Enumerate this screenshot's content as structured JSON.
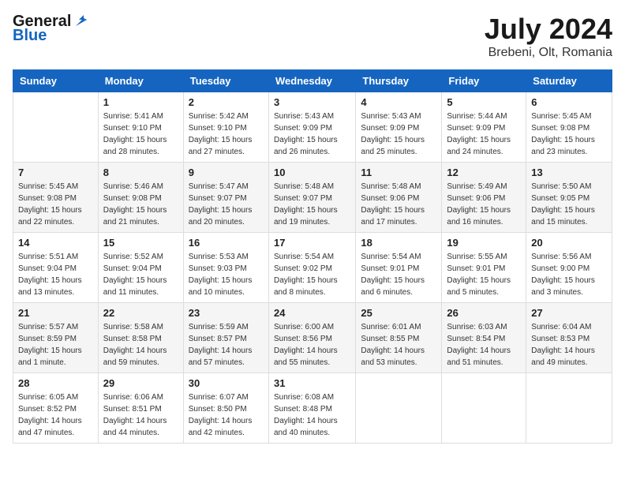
{
  "header": {
    "logo_line1": "General",
    "logo_line2": "Blue",
    "month_year": "July 2024",
    "location": "Brebeni, Olt, Romania"
  },
  "weekdays": [
    "Sunday",
    "Monday",
    "Tuesday",
    "Wednesday",
    "Thursday",
    "Friday",
    "Saturday"
  ],
  "weeks": [
    [
      {
        "day": "",
        "sunrise": "",
        "sunset": "",
        "daylight": ""
      },
      {
        "day": "1",
        "sunrise": "Sunrise: 5:41 AM",
        "sunset": "Sunset: 9:10 PM",
        "daylight": "Daylight: 15 hours and 28 minutes."
      },
      {
        "day": "2",
        "sunrise": "Sunrise: 5:42 AM",
        "sunset": "Sunset: 9:10 PM",
        "daylight": "Daylight: 15 hours and 27 minutes."
      },
      {
        "day": "3",
        "sunrise": "Sunrise: 5:43 AM",
        "sunset": "Sunset: 9:09 PM",
        "daylight": "Daylight: 15 hours and 26 minutes."
      },
      {
        "day": "4",
        "sunrise": "Sunrise: 5:43 AM",
        "sunset": "Sunset: 9:09 PM",
        "daylight": "Daylight: 15 hours and 25 minutes."
      },
      {
        "day": "5",
        "sunrise": "Sunrise: 5:44 AM",
        "sunset": "Sunset: 9:09 PM",
        "daylight": "Daylight: 15 hours and 24 minutes."
      },
      {
        "day": "6",
        "sunrise": "Sunrise: 5:45 AM",
        "sunset": "Sunset: 9:08 PM",
        "daylight": "Daylight: 15 hours and 23 minutes."
      }
    ],
    [
      {
        "day": "7",
        "sunrise": "Sunrise: 5:45 AM",
        "sunset": "Sunset: 9:08 PM",
        "daylight": "Daylight: 15 hours and 22 minutes."
      },
      {
        "day": "8",
        "sunrise": "Sunrise: 5:46 AM",
        "sunset": "Sunset: 9:08 PM",
        "daylight": "Daylight: 15 hours and 21 minutes."
      },
      {
        "day": "9",
        "sunrise": "Sunrise: 5:47 AM",
        "sunset": "Sunset: 9:07 PM",
        "daylight": "Daylight: 15 hours and 20 minutes."
      },
      {
        "day": "10",
        "sunrise": "Sunrise: 5:48 AM",
        "sunset": "Sunset: 9:07 PM",
        "daylight": "Daylight: 15 hours and 19 minutes."
      },
      {
        "day": "11",
        "sunrise": "Sunrise: 5:48 AM",
        "sunset": "Sunset: 9:06 PM",
        "daylight": "Daylight: 15 hours and 17 minutes."
      },
      {
        "day": "12",
        "sunrise": "Sunrise: 5:49 AM",
        "sunset": "Sunset: 9:06 PM",
        "daylight": "Daylight: 15 hours and 16 minutes."
      },
      {
        "day": "13",
        "sunrise": "Sunrise: 5:50 AM",
        "sunset": "Sunset: 9:05 PM",
        "daylight": "Daylight: 15 hours and 15 minutes."
      }
    ],
    [
      {
        "day": "14",
        "sunrise": "Sunrise: 5:51 AM",
        "sunset": "Sunset: 9:04 PM",
        "daylight": "Daylight: 15 hours and 13 minutes."
      },
      {
        "day": "15",
        "sunrise": "Sunrise: 5:52 AM",
        "sunset": "Sunset: 9:04 PM",
        "daylight": "Daylight: 15 hours and 11 minutes."
      },
      {
        "day": "16",
        "sunrise": "Sunrise: 5:53 AM",
        "sunset": "Sunset: 9:03 PM",
        "daylight": "Daylight: 15 hours and 10 minutes."
      },
      {
        "day": "17",
        "sunrise": "Sunrise: 5:54 AM",
        "sunset": "Sunset: 9:02 PM",
        "daylight": "Daylight: 15 hours and 8 minutes."
      },
      {
        "day": "18",
        "sunrise": "Sunrise: 5:54 AM",
        "sunset": "Sunset: 9:01 PM",
        "daylight": "Daylight: 15 hours and 6 minutes."
      },
      {
        "day": "19",
        "sunrise": "Sunrise: 5:55 AM",
        "sunset": "Sunset: 9:01 PM",
        "daylight": "Daylight: 15 hours and 5 minutes."
      },
      {
        "day": "20",
        "sunrise": "Sunrise: 5:56 AM",
        "sunset": "Sunset: 9:00 PM",
        "daylight": "Daylight: 15 hours and 3 minutes."
      }
    ],
    [
      {
        "day": "21",
        "sunrise": "Sunrise: 5:57 AM",
        "sunset": "Sunset: 8:59 PM",
        "daylight": "Daylight: 15 hours and 1 minute."
      },
      {
        "day": "22",
        "sunrise": "Sunrise: 5:58 AM",
        "sunset": "Sunset: 8:58 PM",
        "daylight": "Daylight: 14 hours and 59 minutes."
      },
      {
        "day": "23",
        "sunrise": "Sunrise: 5:59 AM",
        "sunset": "Sunset: 8:57 PM",
        "daylight": "Daylight: 14 hours and 57 minutes."
      },
      {
        "day": "24",
        "sunrise": "Sunrise: 6:00 AM",
        "sunset": "Sunset: 8:56 PM",
        "daylight": "Daylight: 14 hours and 55 minutes."
      },
      {
        "day": "25",
        "sunrise": "Sunrise: 6:01 AM",
        "sunset": "Sunset: 8:55 PM",
        "daylight": "Daylight: 14 hours and 53 minutes."
      },
      {
        "day": "26",
        "sunrise": "Sunrise: 6:03 AM",
        "sunset": "Sunset: 8:54 PM",
        "daylight": "Daylight: 14 hours and 51 minutes."
      },
      {
        "day": "27",
        "sunrise": "Sunrise: 6:04 AM",
        "sunset": "Sunset: 8:53 PM",
        "daylight": "Daylight: 14 hours and 49 minutes."
      }
    ],
    [
      {
        "day": "28",
        "sunrise": "Sunrise: 6:05 AM",
        "sunset": "Sunset: 8:52 PM",
        "daylight": "Daylight: 14 hours and 47 minutes."
      },
      {
        "day": "29",
        "sunrise": "Sunrise: 6:06 AM",
        "sunset": "Sunset: 8:51 PM",
        "daylight": "Daylight: 14 hours and 44 minutes."
      },
      {
        "day": "30",
        "sunrise": "Sunrise: 6:07 AM",
        "sunset": "Sunset: 8:50 PM",
        "daylight": "Daylight: 14 hours and 42 minutes."
      },
      {
        "day": "31",
        "sunrise": "Sunrise: 6:08 AM",
        "sunset": "Sunset: 8:48 PM",
        "daylight": "Daylight: 14 hours and 40 minutes."
      },
      {
        "day": "",
        "sunrise": "",
        "sunset": "",
        "daylight": ""
      },
      {
        "day": "",
        "sunrise": "",
        "sunset": "",
        "daylight": ""
      },
      {
        "day": "",
        "sunrise": "",
        "sunset": "",
        "daylight": ""
      }
    ]
  ]
}
